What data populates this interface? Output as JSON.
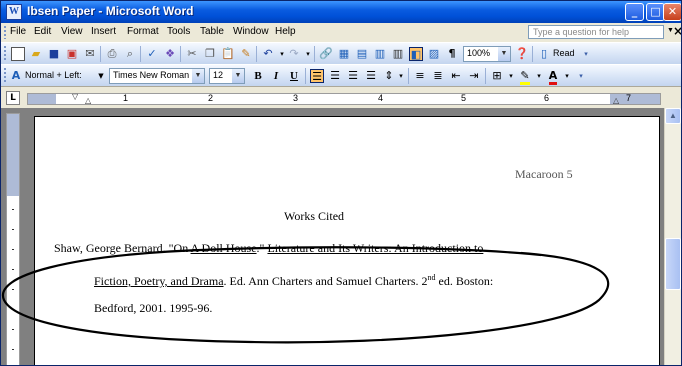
{
  "window": {
    "title": "Ibsen Paper - Microsoft Word"
  },
  "menu": {
    "items": [
      "File",
      "Edit",
      "View",
      "Insert",
      "Format",
      "Tools",
      "Table",
      "Window",
      "Help"
    ],
    "help_placeholder": "Type a question for help"
  },
  "standard_toolbar": {
    "zoom": "100%",
    "read_label": "Read"
  },
  "formatting_toolbar": {
    "style": "Normal + Left:",
    "font": "Times New Roman",
    "size": "12",
    "bold": "B",
    "italic": "I",
    "underline": "U"
  },
  "ruler": {
    "numbers": [
      "1",
      "2",
      "3",
      "4",
      "5",
      "6",
      "7"
    ]
  },
  "document": {
    "header": "Macaroon 5",
    "heading": "Works Cited",
    "citation": {
      "author": "Shaw, George Bernard.",
      "quote_open": "\"On ",
      "work": "A Doll House",
      "quote_close": ".\"",
      "anthology_part1": "Literature and Its Writers: An Introduction to",
      "anthology_part2": "Fiction, Poetry, and Drama",
      "editors": ". Ed. Ann Charters and Samuel Charters. 2",
      "edition_sup": "nd",
      "edition_rest": " ed. Boston:",
      "publication": "Bedford, 2001. 1995-96."
    }
  },
  "colors": {
    "title_bar": "#0054e3",
    "annotation_ellipse": "#000000"
  }
}
